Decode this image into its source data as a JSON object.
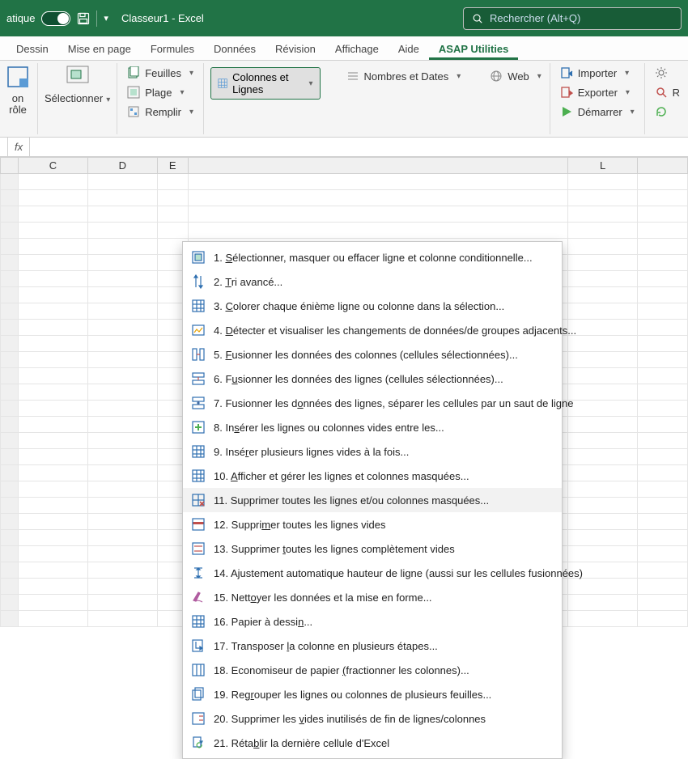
{
  "titlebar": {
    "autosave_label": "atique",
    "doc_title": "Classeur1  -  Excel",
    "search_placeholder": "Rechercher (Alt+Q)"
  },
  "tabs": [
    {
      "label": "Dessin"
    },
    {
      "label": "Mise en page"
    },
    {
      "label": "Formules"
    },
    {
      "label": "Données"
    },
    {
      "label": "Révision"
    },
    {
      "label": "Affichage"
    },
    {
      "label": "Aide"
    },
    {
      "label": "ASAP Utilities",
      "active": true
    }
  ],
  "ribbon": {
    "big1": {
      "line1": "on",
      "line2": "rôle"
    },
    "big2": {
      "line1": "Sélectionner"
    },
    "group_feuilles": {
      "feuilles": "Feuilles",
      "plage": "Plage",
      "remplir": "Remplir"
    },
    "dropbtn": "Colonnes et Lignes",
    "nombres": "Nombres et Dates",
    "web": "Web",
    "right_group": {
      "importer": "Importer",
      "exporter": "Exporter",
      "demarrer": "Démarrer"
    },
    "right2": {
      "r": "R"
    }
  },
  "menu": [
    {
      "n": "1.",
      "text": "Sélectionner, masquer ou effacer ligne et colonne conditionnelle...",
      "u": 0,
      "icon": "select"
    },
    {
      "n": "2.",
      "text": "Tri avancé...",
      "u": 0,
      "icon": "sort"
    },
    {
      "n": "3.",
      "text": "Colorer chaque énième ligne ou colonne dans la sélection...",
      "u": 0,
      "icon": "grid"
    },
    {
      "n": "4.",
      "text": "Détecter et visualiser les changements de données/de groupes adjacents...",
      "u": 0,
      "icon": "detect"
    },
    {
      "n": "5.",
      "text": "Fusionner les données des colonnes (cellules sélectionnées)...",
      "u": 0,
      "icon": "merge-col"
    },
    {
      "n": "6.",
      "text": "Fusionner les données des lignes  (cellules sélectionnées)...",
      "u": 1,
      "icon": "merge-row"
    },
    {
      "n": "7.",
      "text": "Fusionner les données des lignes, séparer les cellules par un saut de ligne",
      "u": 15,
      "icon": "merge-br"
    },
    {
      "n": "8.",
      "text": "Insérer les lignes ou colonnes vides entre les...",
      "u": 2,
      "icon": "insert"
    },
    {
      "n": "9.",
      "text": "Insérer plusieurs lignes vides à la fois...",
      "u": 4,
      "icon": "grid"
    },
    {
      "n": "10.",
      "text": "Afficher et gérer les lignes et colonnes masquées...",
      "u": 0,
      "icon": "grid"
    },
    {
      "n": "11.",
      "text": "Supprimer toutes les lignes et/ou colonnes masquées...",
      "u": -1,
      "icon": "grid-x",
      "hover": true
    },
    {
      "n": "12.",
      "text": "Supprimer toutes les lignes vides",
      "u": 6,
      "icon": "del-row"
    },
    {
      "n": "13.",
      "text": "Supprimer toutes les lignes complètement vides",
      "u": 10,
      "icon": "del-row2"
    },
    {
      "n": "14.",
      "text": "Ajustement automatique hauteur de ligne (aussi sur les cellules fusionnées)",
      "u": -1,
      "icon": "height"
    },
    {
      "n": "15.",
      "text": "Nettoyer les données et la mise en forme...",
      "u": 4,
      "icon": "clean"
    },
    {
      "n": "16.",
      "text": "Papier à dessin...",
      "u": 14,
      "icon": "draw"
    },
    {
      "n": "17.",
      "text": "Transposer la colonne en plusieurs étapes...",
      "u": 11,
      "icon": "transpose"
    },
    {
      "n": "18.",
      "text": "Economiseur de papier (fractionner les colonnes)...",
      "u": 22,
      "icon": "paper"
    },
    {
      "n": "19.",
      "text": "Regrouper les lignes ou colonnes de plusieurs feuilles...",
      "u": 3,
      "icon": "group"
    },
    {
      "n": "20.",
      "text": "Supprimer les vides inutilisés de fin de lignes/colonnes",
      "u": 14,
      "icon": "trim"
    },
    {
      "n": "21.",
      "text": "Rétablir la dernière cellule d'Excel",
      "u": 4,
      "icon": "reset"
    }
  ],
  "columns": [
    "C",
    "D",
    "E",
    "",
    "L",
    ""
  ],
  "fx_label": "fx"
}
